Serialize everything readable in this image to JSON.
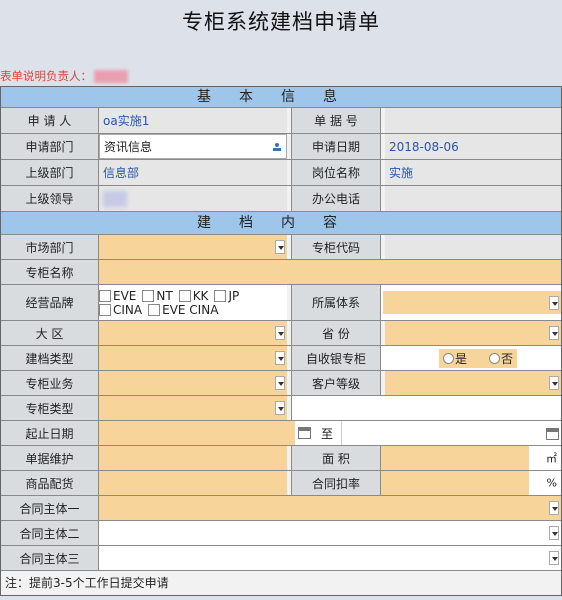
{
  "title": "专柜系统建档申请单",
  "responsible_label": "表单说明负责人：",
  "section_basic": "基本信息",
  "section_content": "建档内容",
  "basic": {
    "applicant_label": "申 请 人",
    "applicant_value": "oa实施1",
    "doc_no_label": "单 据 号",
    "dept_label": "申请部门",
    "dept_value": "资讯信息",
    "date_label": "申请日期",
    "date_value": "2018-08-06",
    "parent_dept_label": "上级部门",
    "parent_dept_value": "信息部",
    "position_label": "岗位名称",
    "position_value": "实施",
    "leader_label": "上级领导",
    "phone_label": "办公电话"
  },
  "content": {
    "market_label": "市场部门",
    "counter_code_label": "专柜代码",
    "counter_name_label": "专柜名称",
    "brand_label": "经营品牌",
    "brands": [
      "EVE",
      "NT",
      "KK",
      "JP",
      "CINA",
      "EVE CINA"
    ],
    "system_label": "所属体系",
    "region_label": "大      区",
    "province_label": "省      份",
    "type_label": "建档类型",
    "self_collect_label": "自收银专柜",
    "yes": "是",
    "no": "否",
    "business_label": "专柜业务",
    "customer_level_label": "客户等级",
    "counter_type_label": "专柜类型",
    "period_label": "起止日期",
    "to": "至",
    "maintain_label": "单据维护",
    "area_label": "面      积",
    "area_unit": "㎡",
    "goods_label": "商品配货",
    "discount_label": "合同扣率",
    "discount_unit": "%",
    "party1_label": "合同主体一",
    "party2_label": "合同主体二",
    "party3_label": "合同主体三"
  },
  "note": "注：提前3-5个工作日提交申请"
}
